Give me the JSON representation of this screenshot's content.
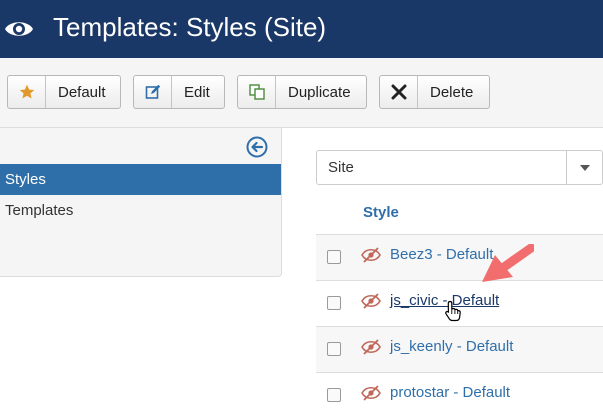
{
  "header": {
    "title": "Templates: Styles (Site)",
    "icon": "eye-icon",
    "background": "#1a3867"
  },
  "toolbar": {
    "buttons": [
      {
        "label": "Default",
        "icon": "star-icon",
        "icon_color": "#e0992a"
      },
      {
        "label": "Edit",
        "icon": "edit-icon",
        "icon_color": "#2f6fa9"
      },
      {
        "label": "Duplicate",
        "icon": "copy-icon",
        "icon_color": "#4a8a3a"
      },
      {
        "label": "Delete",
        "icon": "close-icon",
        "icon_color": "#222222"
      }
    ]
  },
  "sidebar": {
    "collapse_icon": "arrow-left-circle-icon",
    "items": [
      {
        "label": "Styles",
        "active": true
      },
      {
        "label": "Templates",
        "active": false
      }
    ],
    "active_color": "#2f6fa9"
  },
  "filter": {
    "selected": "Site",
    "icon": "caret-down-icon"
  },
  "table": {
    "column_header": "Style",
    "rows": [
      {
        "name": "Beez3 - Default",
        "status_icon": "eye-slash-icon",
        "checked": false
      },
      {
        "name": "js_civic - Default",
        "status_icon": "eye-slash-icon",
        "checked": false,
        "hovered": true
      },
      {
        "name": "js_keenly - Default",
        "status_icon": "eye-slash-icon",
        "checked": false
      },
      {
        "name": "protostar - Default",
        "status_icon": "eye-slash-icon",
        "checked": false
      }
    ],
    "link_color": "#2f6fa9",
    "status_color": "#c0675a"
  },
  "annotation": {
    "icon": "red-arrow-icon",
    "color": "#f26d6d"
  }
}
